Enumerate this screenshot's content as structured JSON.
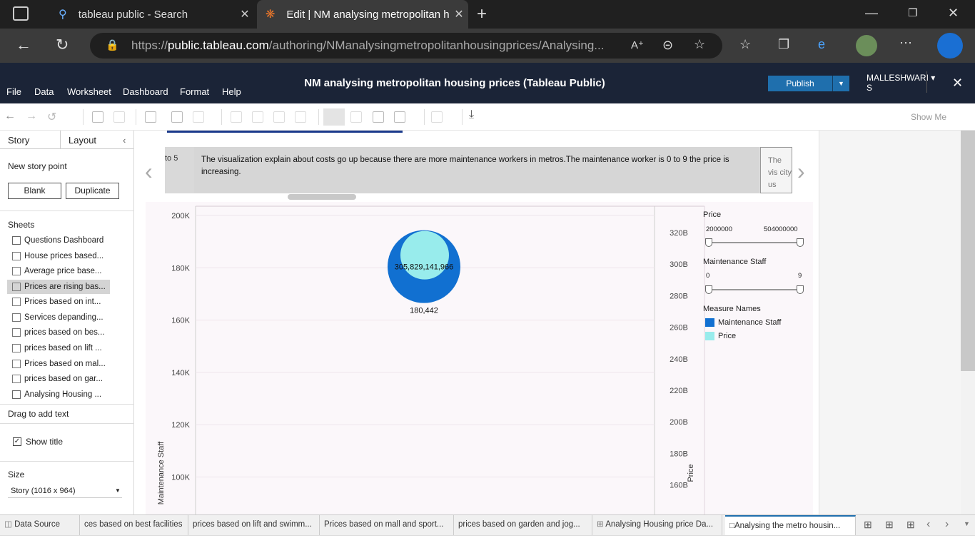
{
  "browser": {
    "tabs": [
      {
        "label": "tableau public - Search",
        "active": false
      },
      {
        "label": "Edit | NM analysing metropolitan housing prices",
        "active": true
      }
    ],
    "url_prefix": "https://",
    "url_domain": "public.tableau.com",
    "url_path": "/authoring/NManalysingmetropolitanhousingprices/Analysing..."
  },
  "app": {
    "menu": [
      "File",
      "Data",
      "Worksheet",
      "Dashboard",
      "Format",
      "Help"
    ],
    "title": "NM analysing metropolitan housing prices (Tableau Public)",
    "publish_label": "Publish",
    "user_line1": "MALLESHWARI ▾",
    "user_line2": "S",
    "show_me": "Show Me"
  },
  "left_pane": {
    "tab_story": "Story",
    "tab_layout": "Layout",
    "new_story_point": "New story point",
    "blank_label": "Blank",
    "duplicate_label": "Duplicate",
    "sheets_heading": "Sheets",
    "sheets": [
      "Questions Dashboard",
      "House prices based...",
      "Average price base...",
      "Prices are rising bas...",
      "Prices based on int...",
      "Services depanding...",
      "prices based on bes...",
      "prices based on lift ...",
      "Prices based on mal...",
      "prices based on gar...",
      "Analysing Housing ..."
    ],
    "drag_text": "Drag to add text",
    "show_title": "Show title",
    "size_heading": "Size",
    "size_value": "Story (1016 x 964)"
  },
  "story": {
    "prev_point_text": "to 5",
    "caption": "The visualization explain about  costs go up because there are more maintenance workers in metros.The maintenance worker is 0 to 9 the price is increasing.",
    "next_point_text": "The vis city us"
  },
  "chart_data": {
    "type": "scatter",
    "left_axis": {
      "label": "Maintenance Staff",
      "ticks": [
        "200K",
        "180K",
        "160K",
        "140K",
        "120K",
        "100K"
      ]
    },
    "right_axis": {
      "label": "Price",
      "ticks": [
        "320B",
        "300B",
        "280B",
        "260B",
        "240B",
        "220B",
        "200B",
        "180B",
        "160B"
      ]
    },
    "points": [
      {
        "series": "Maintenance Staff",
        "value": 180442,
        "label": "180,442"
      },
      {
        "series": "Price",
        "value": 305829141966,
        "label": "305,829,141,966"
      }
    ],
    "legend_title": "Measure Names",
    "legend": [
      {
        "name": "Maintenance Staff",
        "color": "#1170d1"
      },
      {
        "name": "Price",
        "color": "#98ecec"
      }
    ]
  },
  "filters": {
    "price": {
      "title": "Price",
      "min": "2000000",
      "max": "504000000"
    },
    "staff": {
      "title": "Maintenance Staff",
      "min": "0",
      "max": "9"
    }
  },
  "bottom_tabs": [
    "Data Source",
    "ces based on best facilities",
    "prices based on lift and swimm...",
    "Prices based on mall and sport...",
    "prices based on garden and jog...",
    "Analysing Housing price Da...",
    "Analysing the metro housin..."
  ]
}
